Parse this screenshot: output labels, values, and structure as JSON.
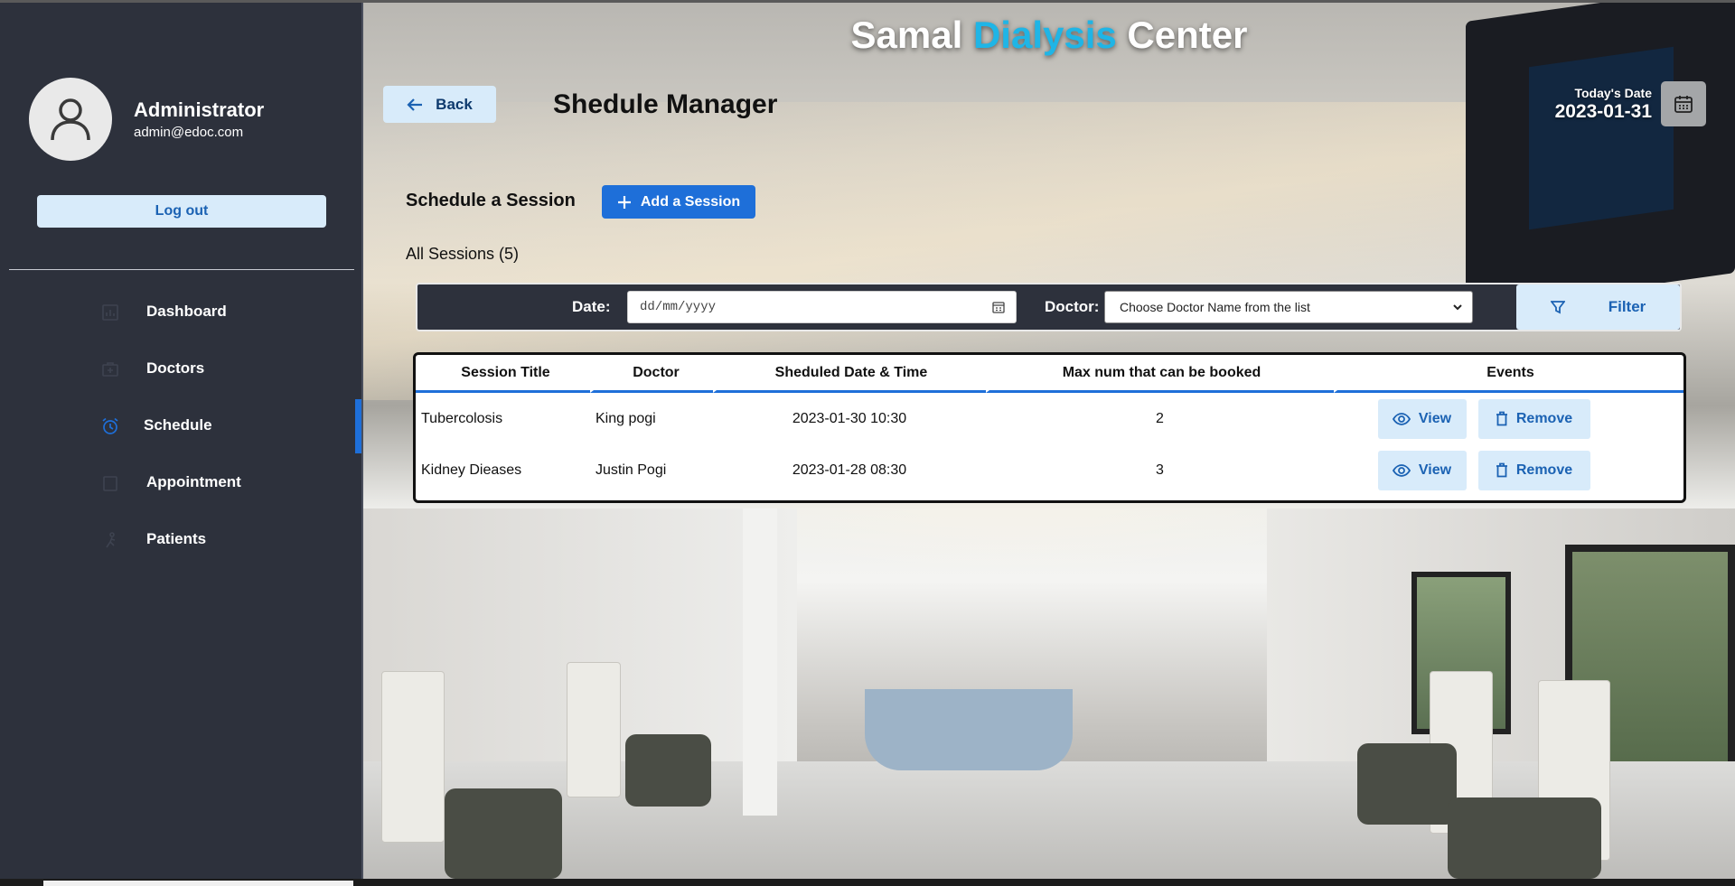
{
  "sidebar": {
    "profile": {
      "name": "Administrator",
      "email": "admin@edoc.com"
    },
    "logout_label": "Log out",
    "nav": [
      {
        "label": "Dashboard",
        "icon": "dashboard-icon",
        "active": false
      },
      {
        "label": "Doctors",
        "icon": "doctor-icon",
        "active": false
      },
      {
        "label": "Schedule",
        "icon": "alarm-clock-icon",
        "active": true
      },
      {
        "label": "Appointment",
        "icon": "appointment-icon",
        "active": false
      },
      {
        "label": "Patients",
        "icon": "patients-icon",
        "active": false
      }
    ]
  },
  "header": {
    "site_title_part1": "Samal ",
    "site_title_accent": "Dialysis",
    "site_title_part2": " Center",
    "back_label": "Back",
    "page_title": "Shedule Manager",
    "today_label": "Today's Date",
    "today_value": "2023-01-31"
  },
  "schedule": {
    "section_label": "Schedule a Session",
    "add_label": "Add a Session",
    "all_sessions_label": "All Sessions (5)"
  },
  "filter": {
    "date_label": "Date:",
    "date_placeholder": "dd/mm/yyyy",
    "doctor_label": "Doctor:",
    "doctor_selected": "Choose Doctor Name from the list",
    "filter_label": "Filter"
  },
  "table": {
    "headers": [
      "Session Title",
      "Doctor",
      "Sheduled Date & Time",
      "Max num that can be booked",
      "Events"
    ],
    "rows": [
      {
        "title": "Tubercolosis",
        "doctor": "King pogi",
        "datetime": "2023-01-30 10:30",
        "max": "2"
      },
      {
        "title": "Kidney Dieases",
        "doctor": "Justin Pogi",
        "datetime": "2023-01-28 08:30",
        "max": "3"
      }
    ],
    "view_label": "View",
    "remove_label": "Remove"
  },
  "colors": {
    "accent": "#1e6fd9",
    "title_accent": "#1fb5e6",
    "sidebar_bg": "#2d313c",
    "soft_button": "#d8ebfa"
  }
}
